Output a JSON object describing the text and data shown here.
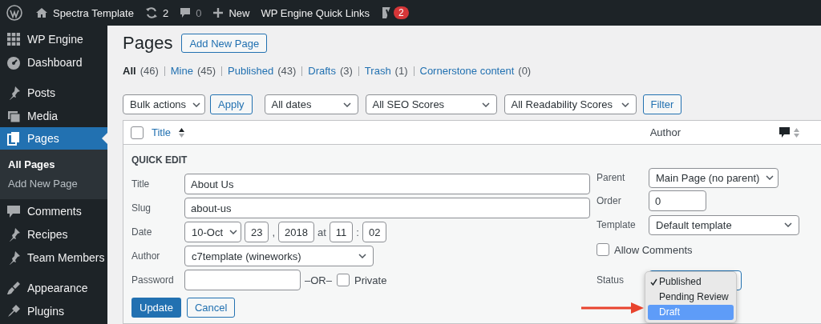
{
  "admin_bar": {
    "site_name": "Spectra Template",
    "updates": "2",
    "comments": "0",
    "new": "New",
    "quick_links": "WP Engine Quick Links",
    "notifications": "2"
  },
  "sidebar": {
    "groups": [
      [
        {
          "label": "WP Engine",
          "selected": false
        },
        {
          "label": "Dashboard",
          "selected": false
        }
      ],
      [
        {
          "label": "Posts",
          "selected": false
        },
        {
          "label": "Media",
          "selected": false
        },
        {
          "label": "Pages",
          "selected": true,
          "children": [
            {
              "label": "All Pages",
              "selected": true
            },
            {
              "label": "Add New Page",
              "selected": false
            }
          ]
        },
        {
          "label": "Comments",
          "selected": false
        },
        {
          "label": "Recipes",
          "selected": false
        },
        {
          "label": "Team Members",
          "selected": false
        }
      ],
      [
        {
          "label": "Appearance",
          "selected": false
        },
        {
          "label": "Plugins",
          "selected": false
        }
      ]
    ]
  },
  "main": {
    "title": "Pages",
    "add_button": "Add New Page",
    "views": [
      {
        "label": "All",
        "count": "(46)",
        "selected": true
      },
      {
        "label": "Mine",
        "count": "(45)",
        "selected": false
      },
      {
        "label": "Published",
        "count": "(43)",
        "selected": false
      },
      {
        "label": "Drafts",
        "count": "(3)",
        "selected": false
      },
      {
        "label": "Trash",
        "count": "(1)",
        "selected": false
      },
      {
        "label": "Cornerstone content",
        "count": "(0)",
        "selected": false
      }
    ],
    "filters": {
      "bulk_actions": "Bulk actions",
      "apply": "Apply",
      "selects": [
        "All dates",
        "All SEO Scores",
        "All Readability Scores"
      ],
      "filter": "Filter"
    },
    "table": {
      "select_all_checked": false,
      "columns": [
        {
          "label": "Title"
        },
        {
          "label": "Author"
        }
      ]
    },
    "quick_edit": {
      "heading": "QUICK EDIT",
      "title_label": "Title",
      "title_value": "About Us",
      "slug_label": "Slug",
      "slug_value": "about-us",
      "date_label": "Date",
      "date": {
        "month": "10-Oct",
        "day": "23",
        "day_sep": ",",
        "year": "2018",
        "at": "at",
        "hour": "11",
        "time_sep": ":",
        "minute": "02"
      },
      "author_label": "Author",
      "author_value": "c7template (wineworks)",
      "password_label": "Password",
      "or_text": "–OR–",
      "private_label": "Private",
      "private_checked": false,
      "update": "Update",
      "cancel": "Cancel",
      "parent_label": "Parent",
      "parent_value": "Main Page (no parent)",
      "order_label": "Order",
      "order_value": "0",
      "template_label": "Template",
      "template_value": "Default template",
      "allow_comments_label": "Allow Comments",
      "allow_comments_checked": false,
      "status_label": "Status",
      "status_options": [
        {
          "label": "Published",
          "checked": true,
          "selected": false
        },
        {
          "label": "Pending Review",
          "checked": false,
          "selected": false
        },
        {
          "label": "Draft",
          "checked": false,
          "selected": true
        }
      ]
    }
  }
}
